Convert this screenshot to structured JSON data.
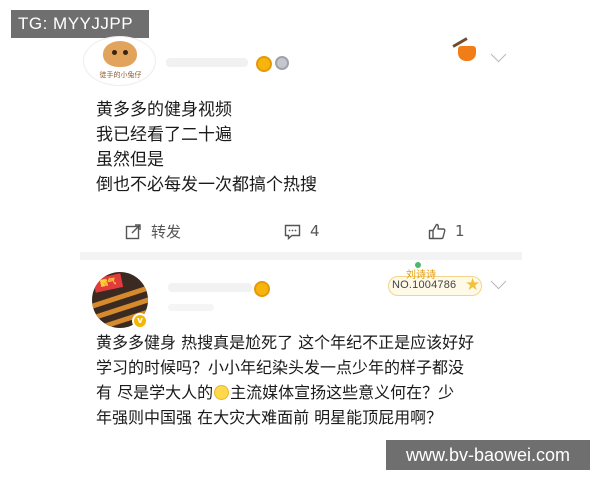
{
  "watermarks": {
    "top_left": "TG: MYYJJPP",
    "bottom_right": "www.bv-baowei.com"
  },
  "post1": {
    "avatar_caption": "徒手的小兔仔",
    "lines": [
      "黄多多的健身视频",
      "我已经看了二十遍",
      "虽然但是",
      "倒也不必每发一次都搞个热搜"
    ],
    "actions": {
      "repost_label": "转发",
      "comment_count": "4",
      "like_count": "1"
    },
    "icons": [
      "gold-badge-icon",
      "silver-badge-icon",
      "sticker-icon",
      "chevron-down-icon",
      "repost-icon",
      "comment-icon",
      "like-icon"
    ]
  },
  "post2": {
    "avatar_label": "霸气",
    "verified_glyph": "v",
    "fan_card": {
      "name": "刘诗诗",
      "number": "NO.1004786",
      "star": "★"
    },
    "lines": [
      "黄多多健身 热搜真是尬死了 这个年纪不正是应该好好",
      "学习的时候吗？小小年纪染头发一点少年的样子都没",
      "有 尽是学大人的",
      "主流媒体宣扬这些意义何在？少",
      "年强则中国强 在大灾大难面前 明星能顶屁用啊？"
    ],
    "icons": [
      "gold-badge-icon",
      "verified-badge-icon",
      "fan-card-star-icon",
      "chevron-down-icon",
      "smirk-emoji-icon"
    ]
  },
  "colors": {
    "badge_gold": "#f6b40c",
    "fan_card_accent": "#e59a00",
    "divider": "#f3f3f3",
    "watermark_bg": "#6f6f6f"
  }
}
